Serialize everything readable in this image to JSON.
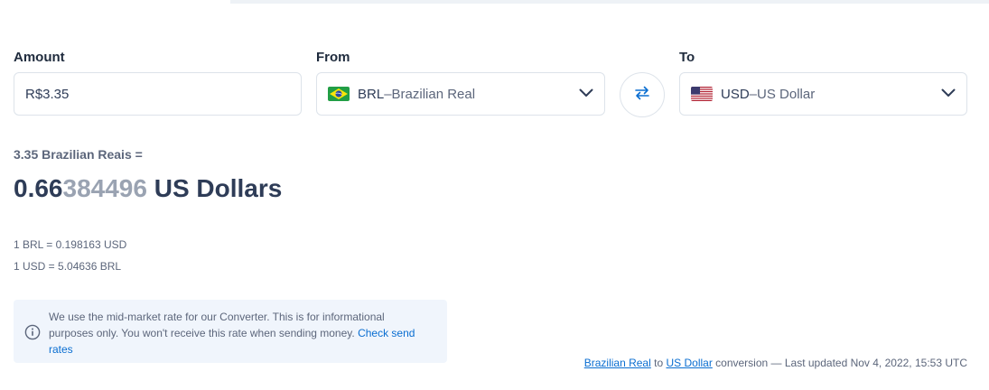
{
  "amount": {
    "label": "Amount",
    "value": "R$3.35"
  },
  "from": {
    "label": "From",
    "code": "BRL",
    "separator": " – ",
    "name": "Brazilian Real",
    "flag_icon": "brazil-flag-icon"
  },
  "to": {
    "label": "To",
    "code": "USD",
    "separator": " – ",
    "name": "US Dollar",
    "flag_icon": "us-flag-icon"
  },
  "result": {
    "from_line": "3.35 Brazilian Reais =",
    "value_strong": "0.66",
    "value_faded": "384496",
    "unit": " US Dollars"
  },
  "rates": [
    "1 BRL = 0.198163 USD",
    "1 USD = 5.04636 BRL"
  ],
  "info": {
    "text": "We use the mid-market rate for our Converter. This is for informational purposes only. You won't receive this rate when sending money. ",
    "link": "Check send rates"
  },
  "footer": {
    "from_link": "Brazilian Real",
    "to_word": " to ",
    "to_link": "US Dollar",
    "suffix": " conversion — Last updated Nov 4, 2022, 15:53 UTC"
  },
  "colors": {
    "accent": "#0a6ed1",
    "text": "#2e3c57",
    "muted": "#5c667b",
    "info_bg": "#f0f5fc"
  }
}
